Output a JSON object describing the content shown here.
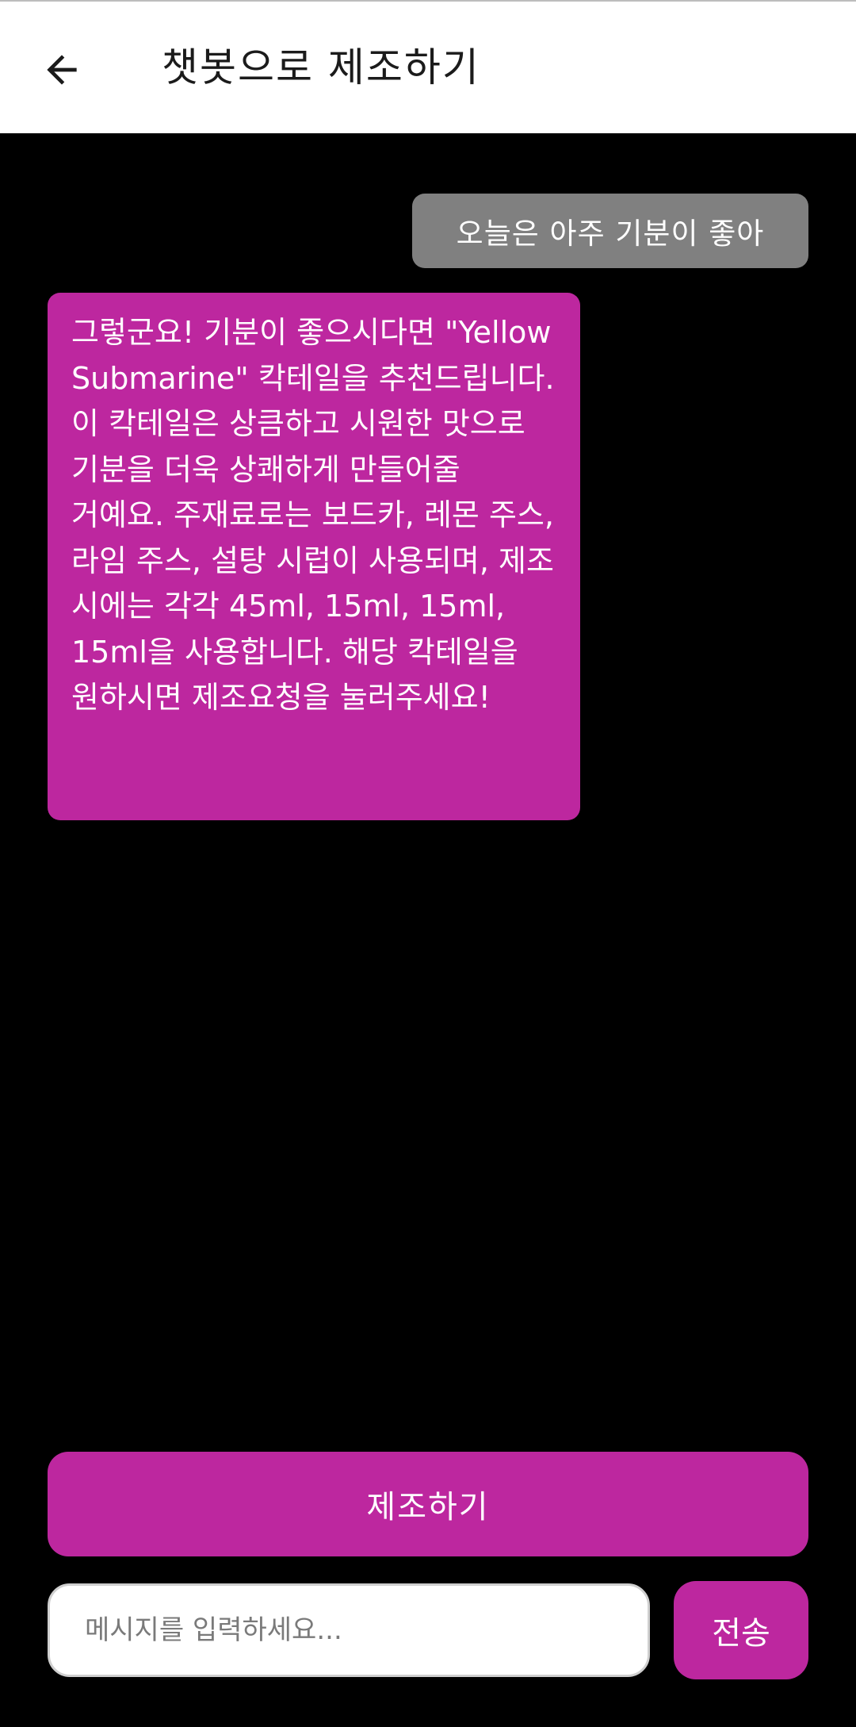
{
  "header": {
    "title": "챗봇으로 제조하기",
    "back_icon": "arrow-left-icon"
  },
  "messages": [
    {
      "sender": "user",
      "text": "오늘은 아주 기분이 좋아"
    },
    {
      "sender": "bot",
      "text": "그렇군요! 기분이 좋으시다면 \"Yellow Submarine\" 칵테일을 추천드립니다. 이 칵테일은 상큼하고 시원한 맛으로 기분을 더욱 상쾌하게 만들어줄 거예요. 주재료로는 보드카, 레몬 주스, 라임 주스, 설탕 시럽이 사용되며, 제조 시에는 각각 45ml, 15ml, 15ml, 15ml을 사용합니다. 해당 칵테일을 원하시면 제조요청을 눌러주세요!"
    }
  ],
  "actions": {
    "make_label": "제조하기",
    "send_label": "전송"
  },
  "input": {
    "placeholder": "메시지를 입력하세요...",
    "value": ""
  },
  "colors": {
    "accent": "#bd279f",
    "user_bubble": "#808080",
    "background": "#000000",
    "header": "#ffffff"
  }
}
